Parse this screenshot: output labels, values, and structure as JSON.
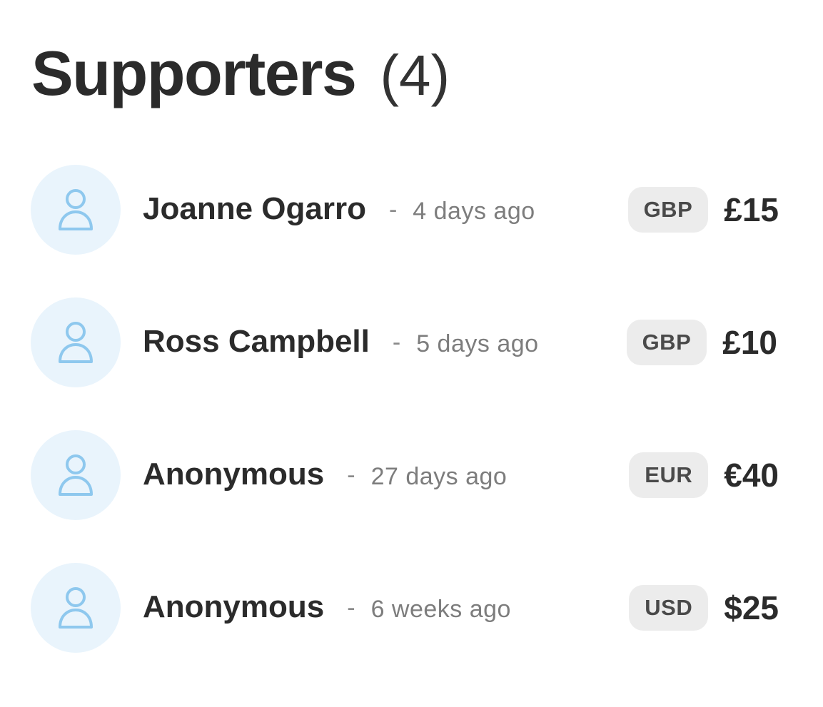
{
  "header": {
    "title": "Supporters",
    "count": "(4)"
  },
  "supporters": [
    {
      "name": "Joanne Ogarro",
      "separator": "-",
      "time": "4 days ago",
      "currency": "GBP",
      "amount": "£15"
    },
    {
      "name": "Ross Campbell",
      "separator": "-",
      "time": "5 days ago",
      "currency": "GBP",
      "amount": "£10"
    },
    {
      "name": "Anonymous",
      "separator": "-",
      "time": "27 days ago",
      "currency": "EUR",
      "amount": "€40"
    },
    {
      "name": "Anonymous",
      "separator": "-",
      "time": "6 weeks ago",
      "currency": "USD",
      "amount": "$25"
    }
  ],
  "colors": {
    "avatar_bg": "#e9f4fc",
    "avatar_icon": "#8ec8ee",
    "currency_badge_bg": "#ececec"
  },
  "icons": {
    "avatar": "user-icon"
  }
}
